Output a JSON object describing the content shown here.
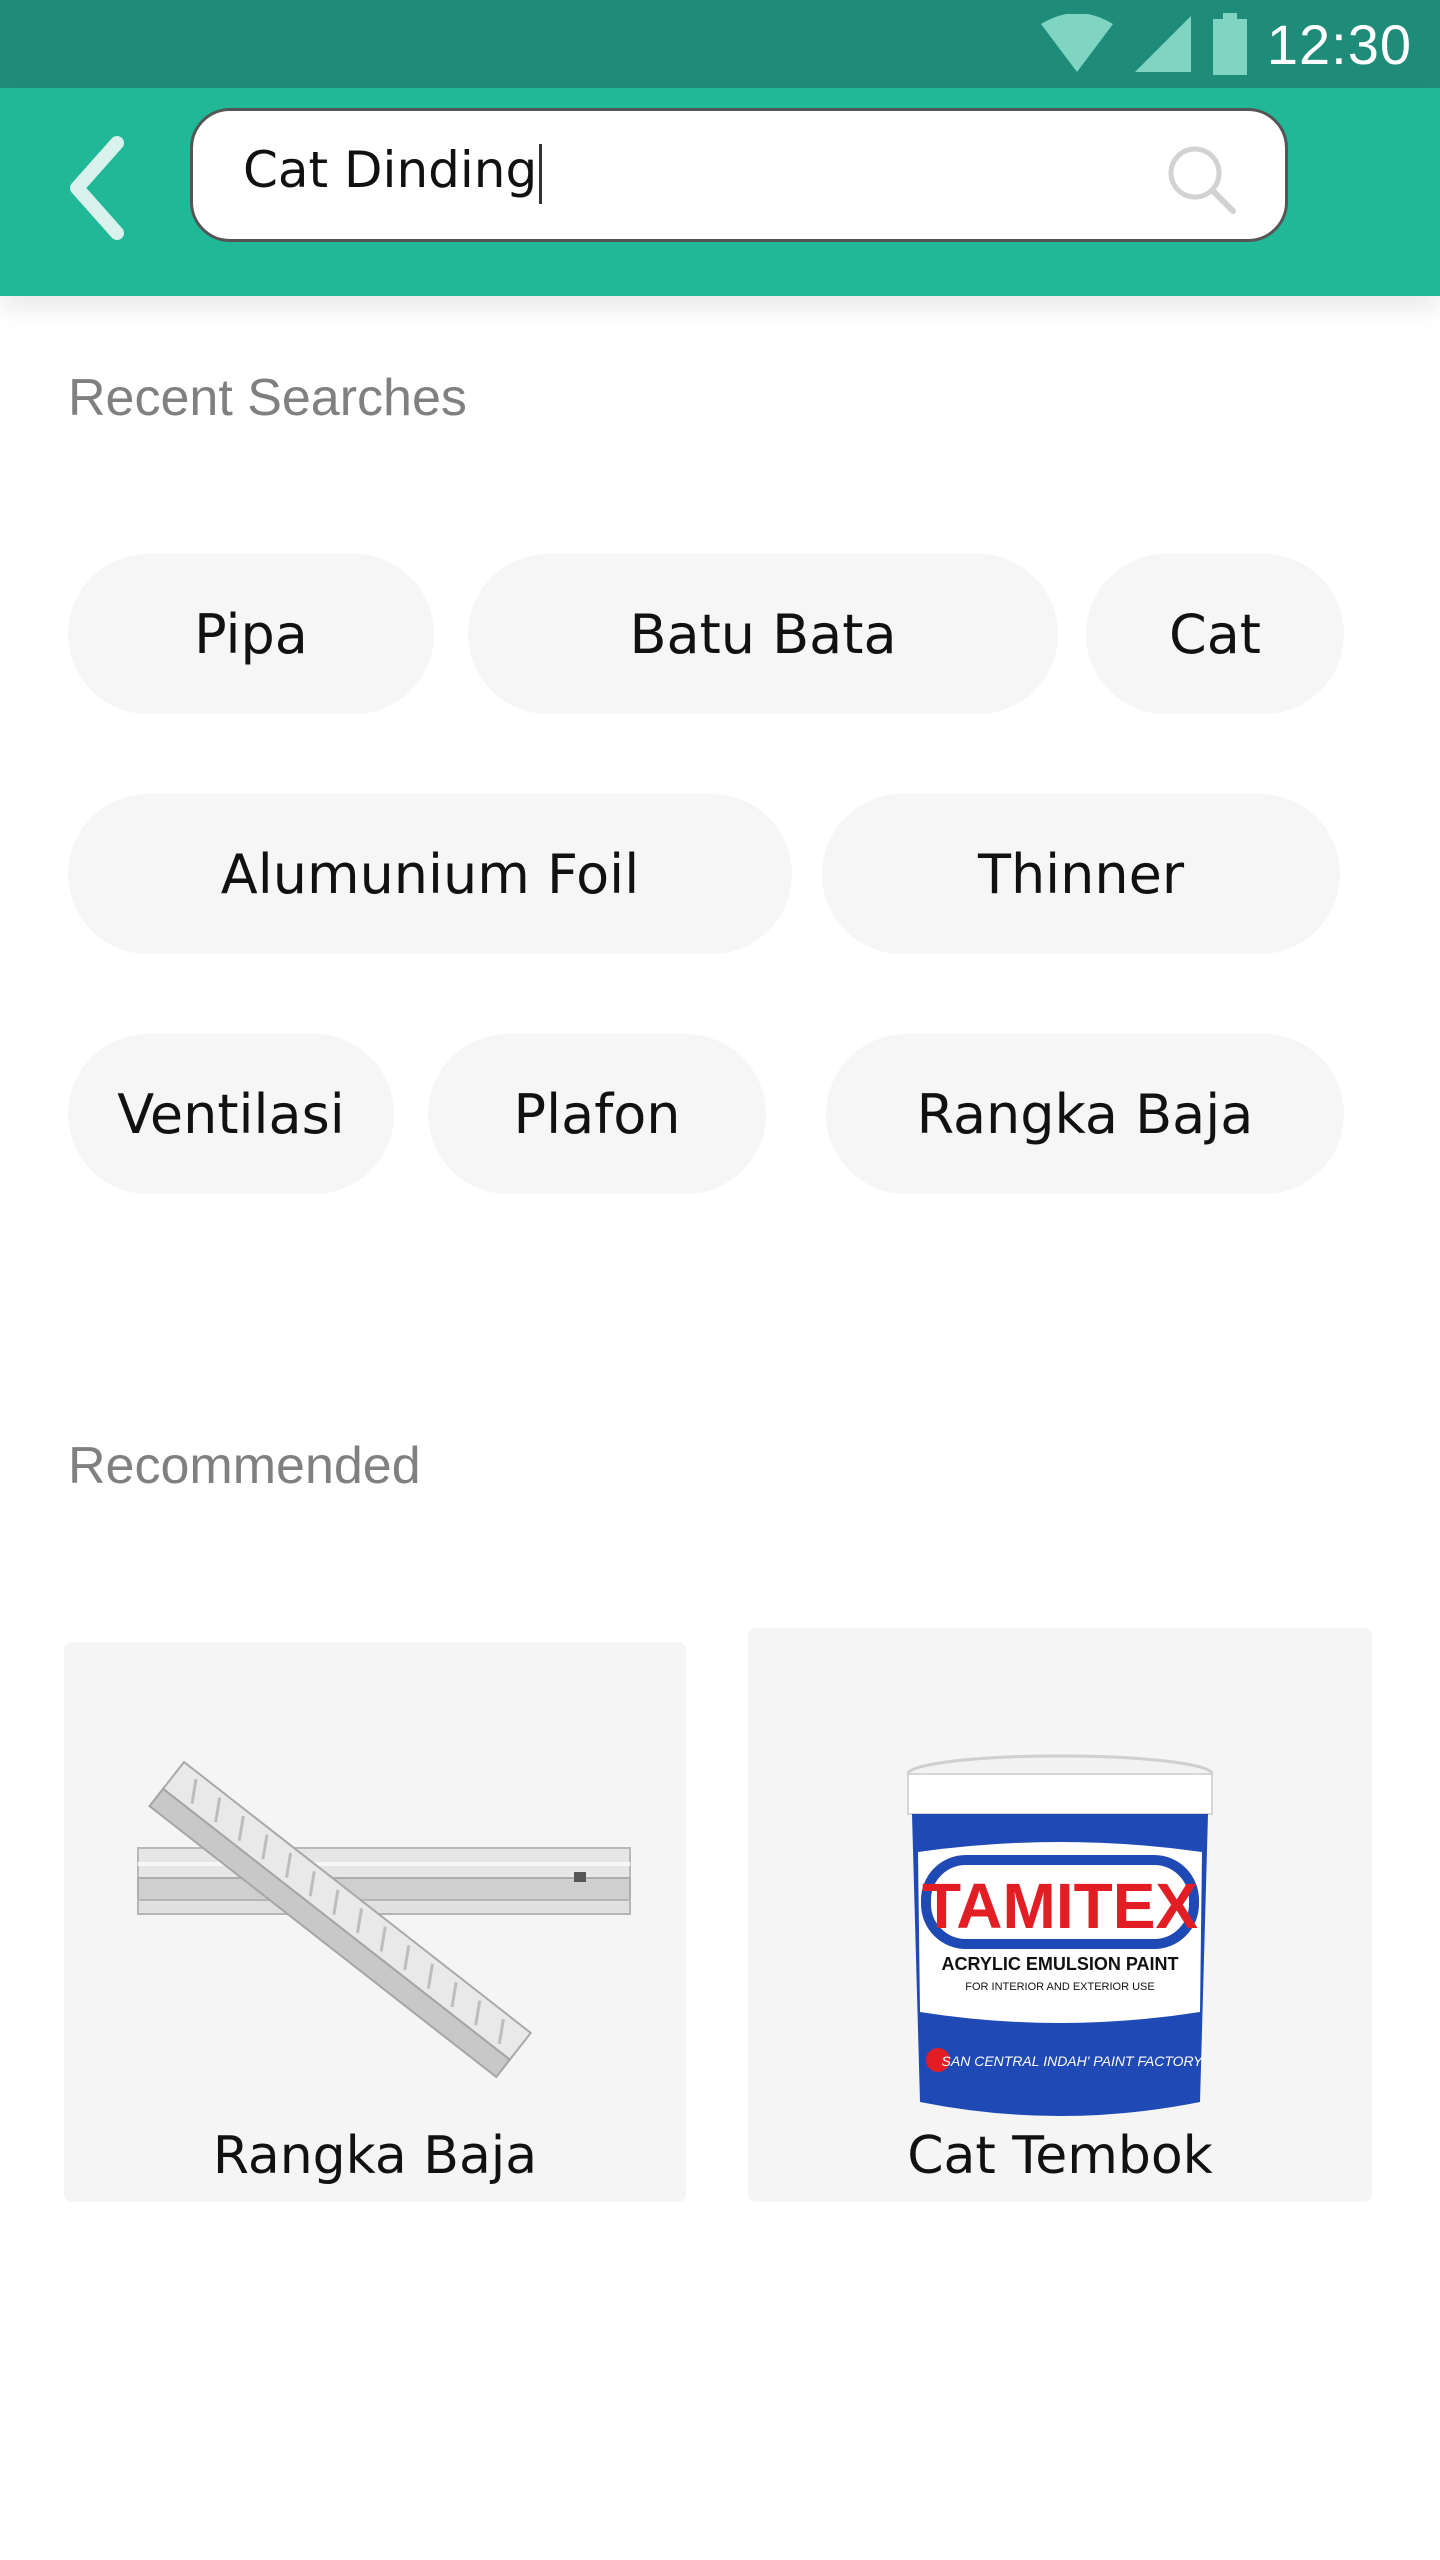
{
  "status_bar": {
    "time": "12:30"
  },
  "search": {
    "value": "Cat Dinding"
  },
  "recent": {
    "title": "Recent Searches",
    "chips": [
      "Pipa",
      "Batu Bata",
      "Cat",
      "Alumunium Foil",
      "Thinner",
      "Ventilasi",
      "Plafon",
      "Rangka Baja"
    ]
  },
  "recommended": {
    "title": "Recommended",
    "items": [
      {
        "label": "Rangka Baja",
        "image": "steel-frame"
      },
      {
        "label": "Cat Tembok",
        "image": "paint-bucket"
      }
    ],
    "paint": {
      "brand": "TAMITEX",
      "line1": "ACRYLIC EMULSION PAINT",
      "line2": "FOR INTERIOR AND EXTERIOR USE",
      "line3": "SAN CENTRAL INDAH' PAINT FACTORY"
    }
  },
  "colors": {
    "status_bar": "#1f8c7a",
    "app_bar": "#20b896",
    "chip_bg": "#f6f6f6",
    "card_bg": "#f5f5f5"
  }
}
